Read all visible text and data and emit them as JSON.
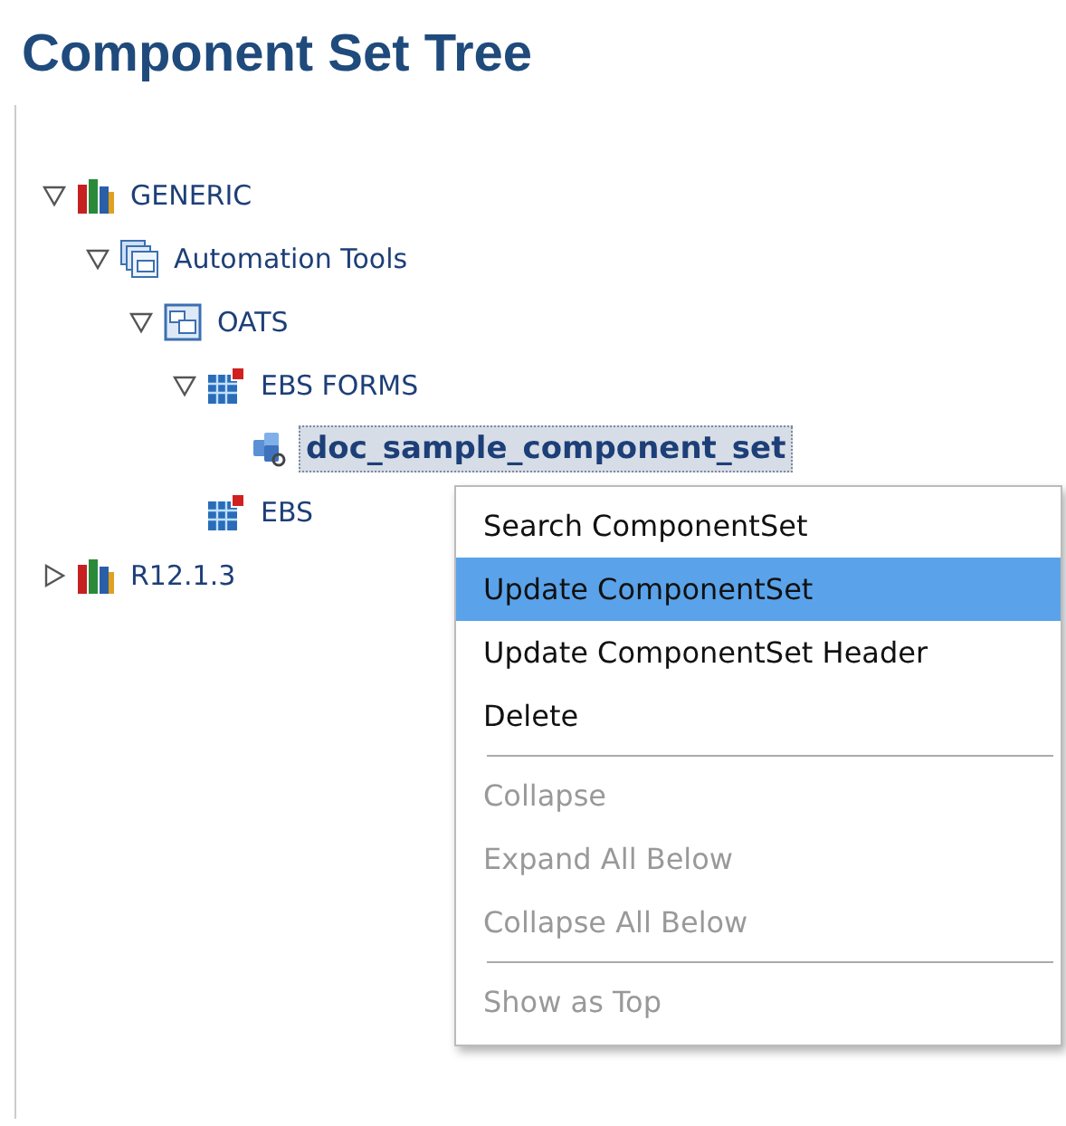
{
  "title": "Component Set Tree",
  "tree": [
    {
      "label": "GENERIC",
      "kind": "books",
      "expanded": true,
      "selected": false,
      "children": [
        {
          "label": "Automation Tools",
          "kind": "windows",
          "expanded": true,
          "selected": false,
          "children": [
            {
              "label": "OATS",
              "kind": "window",
              "expanded": true,
              "selected": false,
              "children": [
                {
                  "label": "EBS FORMS",
                  "kind": "grid",
                  "expanded": true,
                  "selected": false,
                  "children": [
                    {
                      "label": "doc_sample_component_set",
                      "kind": "cubes",
                      "selected": true
                    }
                  ]
                },
                {
                  "label": "EBS",
                  "kind": "grid",
                  "selected": false
                }
              ]
            }
          ]
        }
      ]
    },
    {
      "label": "R12.1.3",
      "kind": "books",
      "expanded": false,
      "selected": false
    }
  ],
  "context_menu": [
    {
      "label": "Search ComponentSet",
      "selected": false,
      "disabled": false
    },
    {
      "label": "Update ComponentSet",
      "selected": true,
      "disabled": false
    },
    {
      "label": "Update ComponentSet Header",
      "selected": false,
      "disabled": false
    },
    {
      "label": "Delete",
      "selected": false,
      "disabled": false,
      "separator_after": true
    },
    {
      "label": "Collapse",
      "selected": false,
      "disabled": true
    },
    {
      "label": "Expand All Below",
      "selected": false,
      "disabled": true
    },
    {
      "label": "Collapse All Below",
      "selected": false,
      "disabled": true,
      "separator_after": true
    },
    {
      "label": "Show as Top",
      "selected": false,
      "disabled": true
    }
  ]
}
